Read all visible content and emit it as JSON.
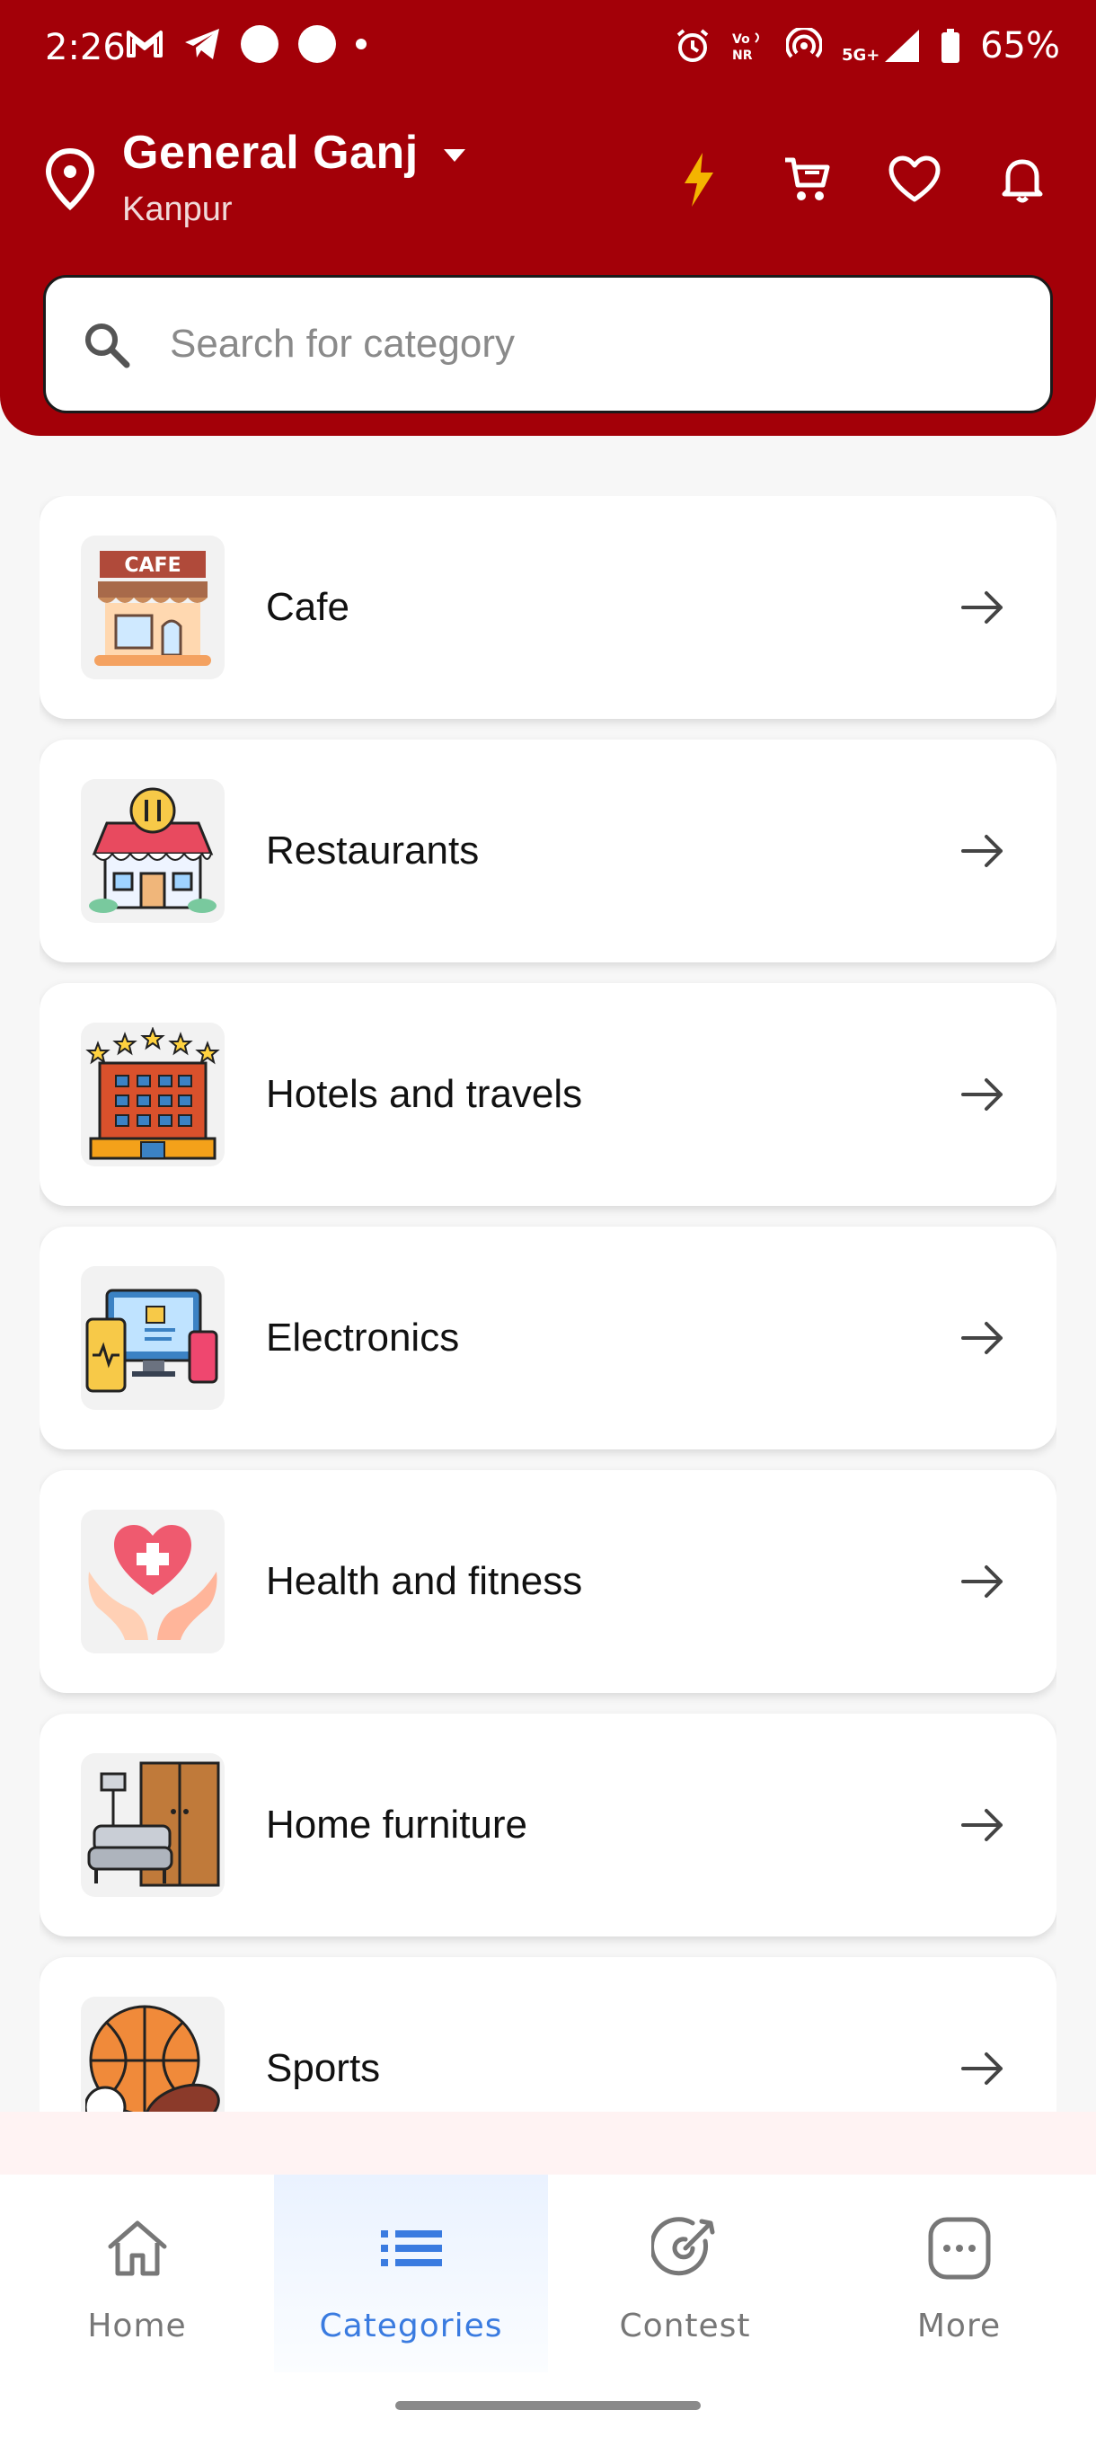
{
  "status_bar": {
    "time": "2:26",
    "battery": "65%"
  },
  "location": {
    "title": "General Ganj",
    "subtitle": "Kanpur"
  },
  "search": {
    "placeholder": "Search for category"
  },
  "categories": [
    {
      "label": "Cafe",
      "icon": "cafe-icon"
    },
    {
      "label": "Restaurants",
      "icon": "restaurant-icon"
    },
    {
      "label": "Hotels and travels",
      "icon": "hotel-icon"
    },
    {
      "label": "Electronics",
      "icon": "electronics-icon"
    },
    {
      "label": "Health and fitness",
      "icon": "health-icon"
    },
    {
      "label": "Home furniture",
      "icon": "furniture-icon"
    },
    {
      "label": "Sports",
      "icon": "sports-icon"
    }
  ],
  "bottom_nav": [
    {
      "label": "Home",
      "active": false
    },
    {
      "label": "Categories",
      "active": true
    },
    {
      "label": "Contest",
      "active": false
    },
    {
      "label": "More",
      "active": false
    }
  ],
  "colors": {
    "header": "#a30008",
    "accent": "#3a7be0",
    "lightning": "#f4b400"
  }
}
